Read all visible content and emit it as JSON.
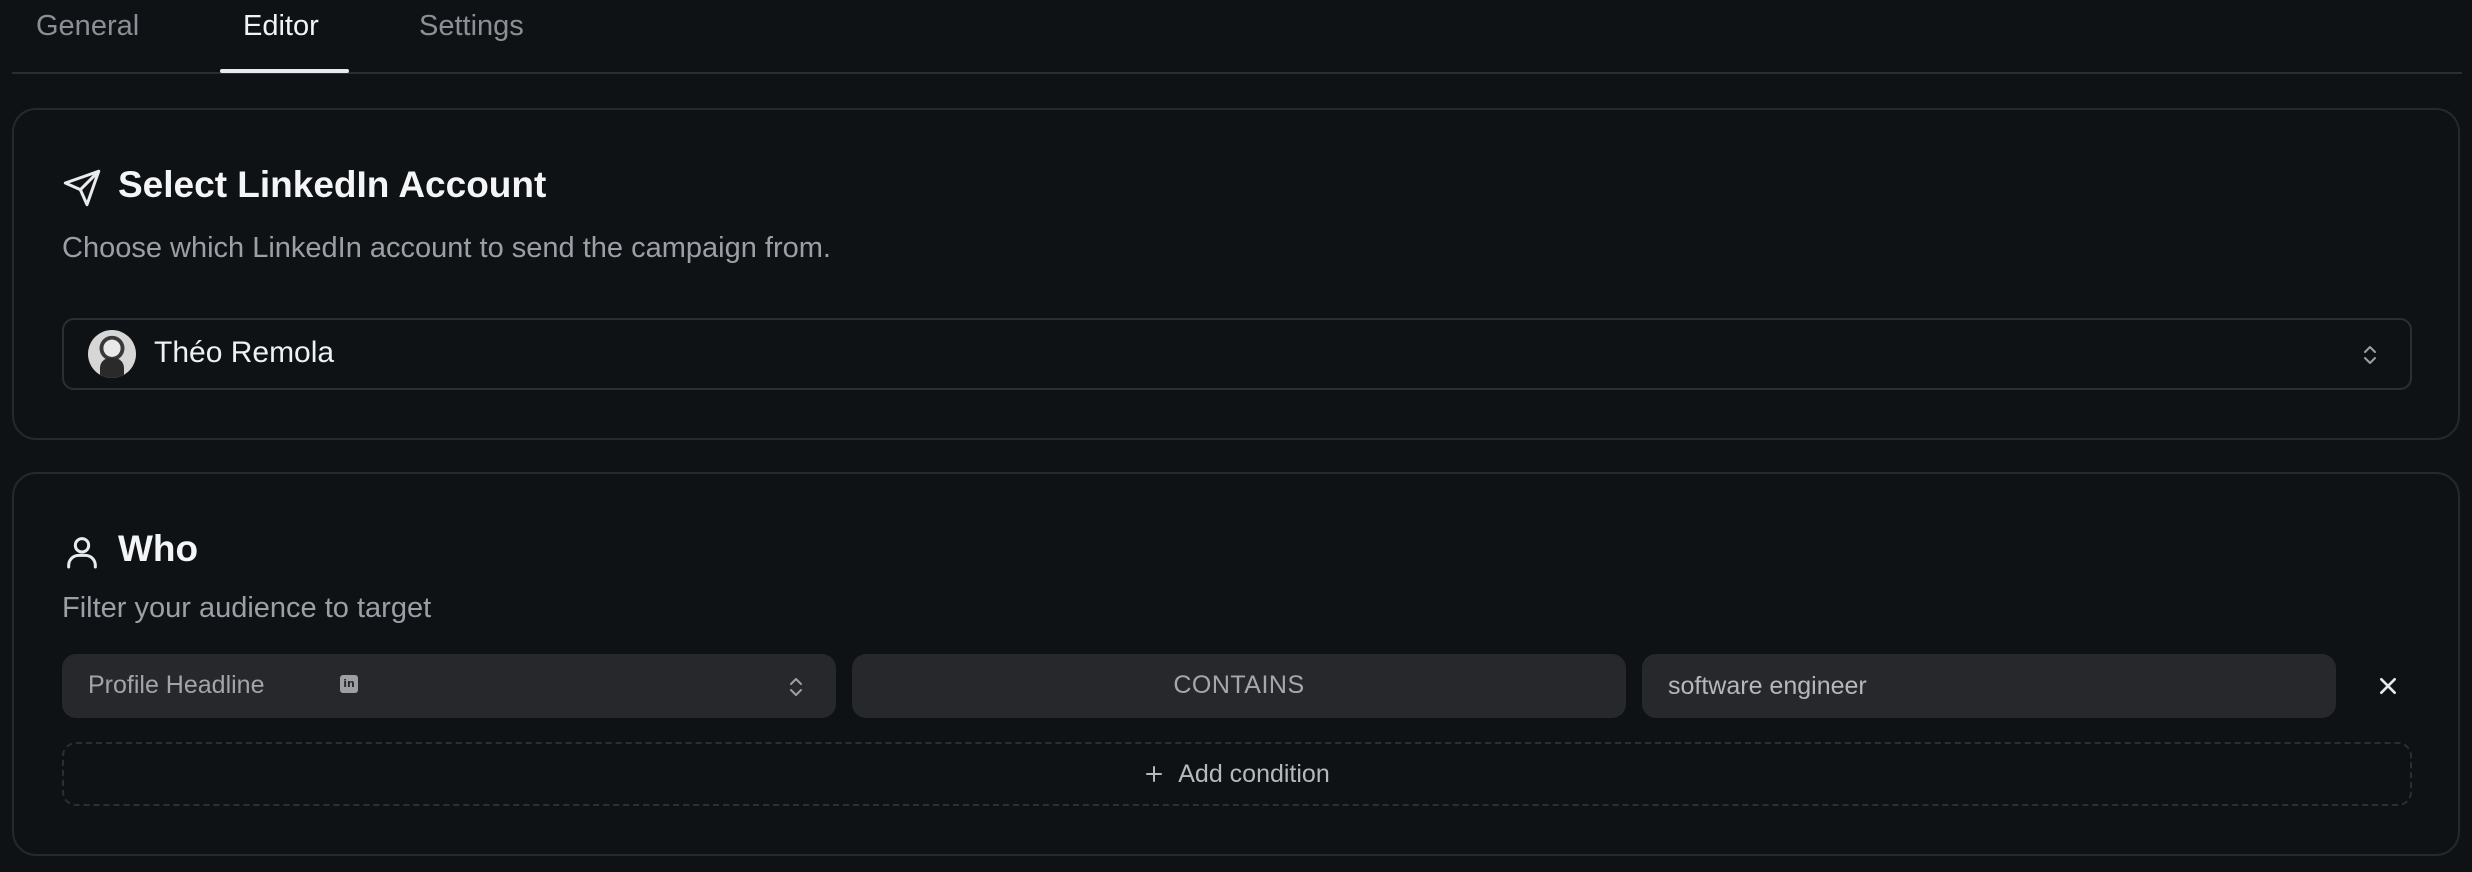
{
  "tabs": [
    {
      "label": "General",
      "active": false
    },
    {
      "label": "Editor",
      "active": true
    },
    {
      "label": "Settings",
      "active": false
    }
  ],
  "account_section": {
    "icon": "send-icon",
    "title": "Select LinkedIn Account",
    "subtitle": "Choose which LinkedIn account to send the campaign from.",
    "selected_account": "Théo Remola"
  },
  "who_section": {
    "icon": "user-icon",
    "title": "Who",
    "subtitle": "Filter your audience to target",
    "condition": {
      "property": "Profile Headline",
      "property_badge": "in",
      "operator": "CONTAINS",
      "value": "software engineer"
    },
    "add_condition_label": "Add condition"
  },
  "colors": {
    "background": "#0f1215",
    "card_border": "#25292e",
    "field_background": "#26282c",
    "text_primary": "#f4f5f6",
    "text_muted": "#9aa0a6"
  }
}
